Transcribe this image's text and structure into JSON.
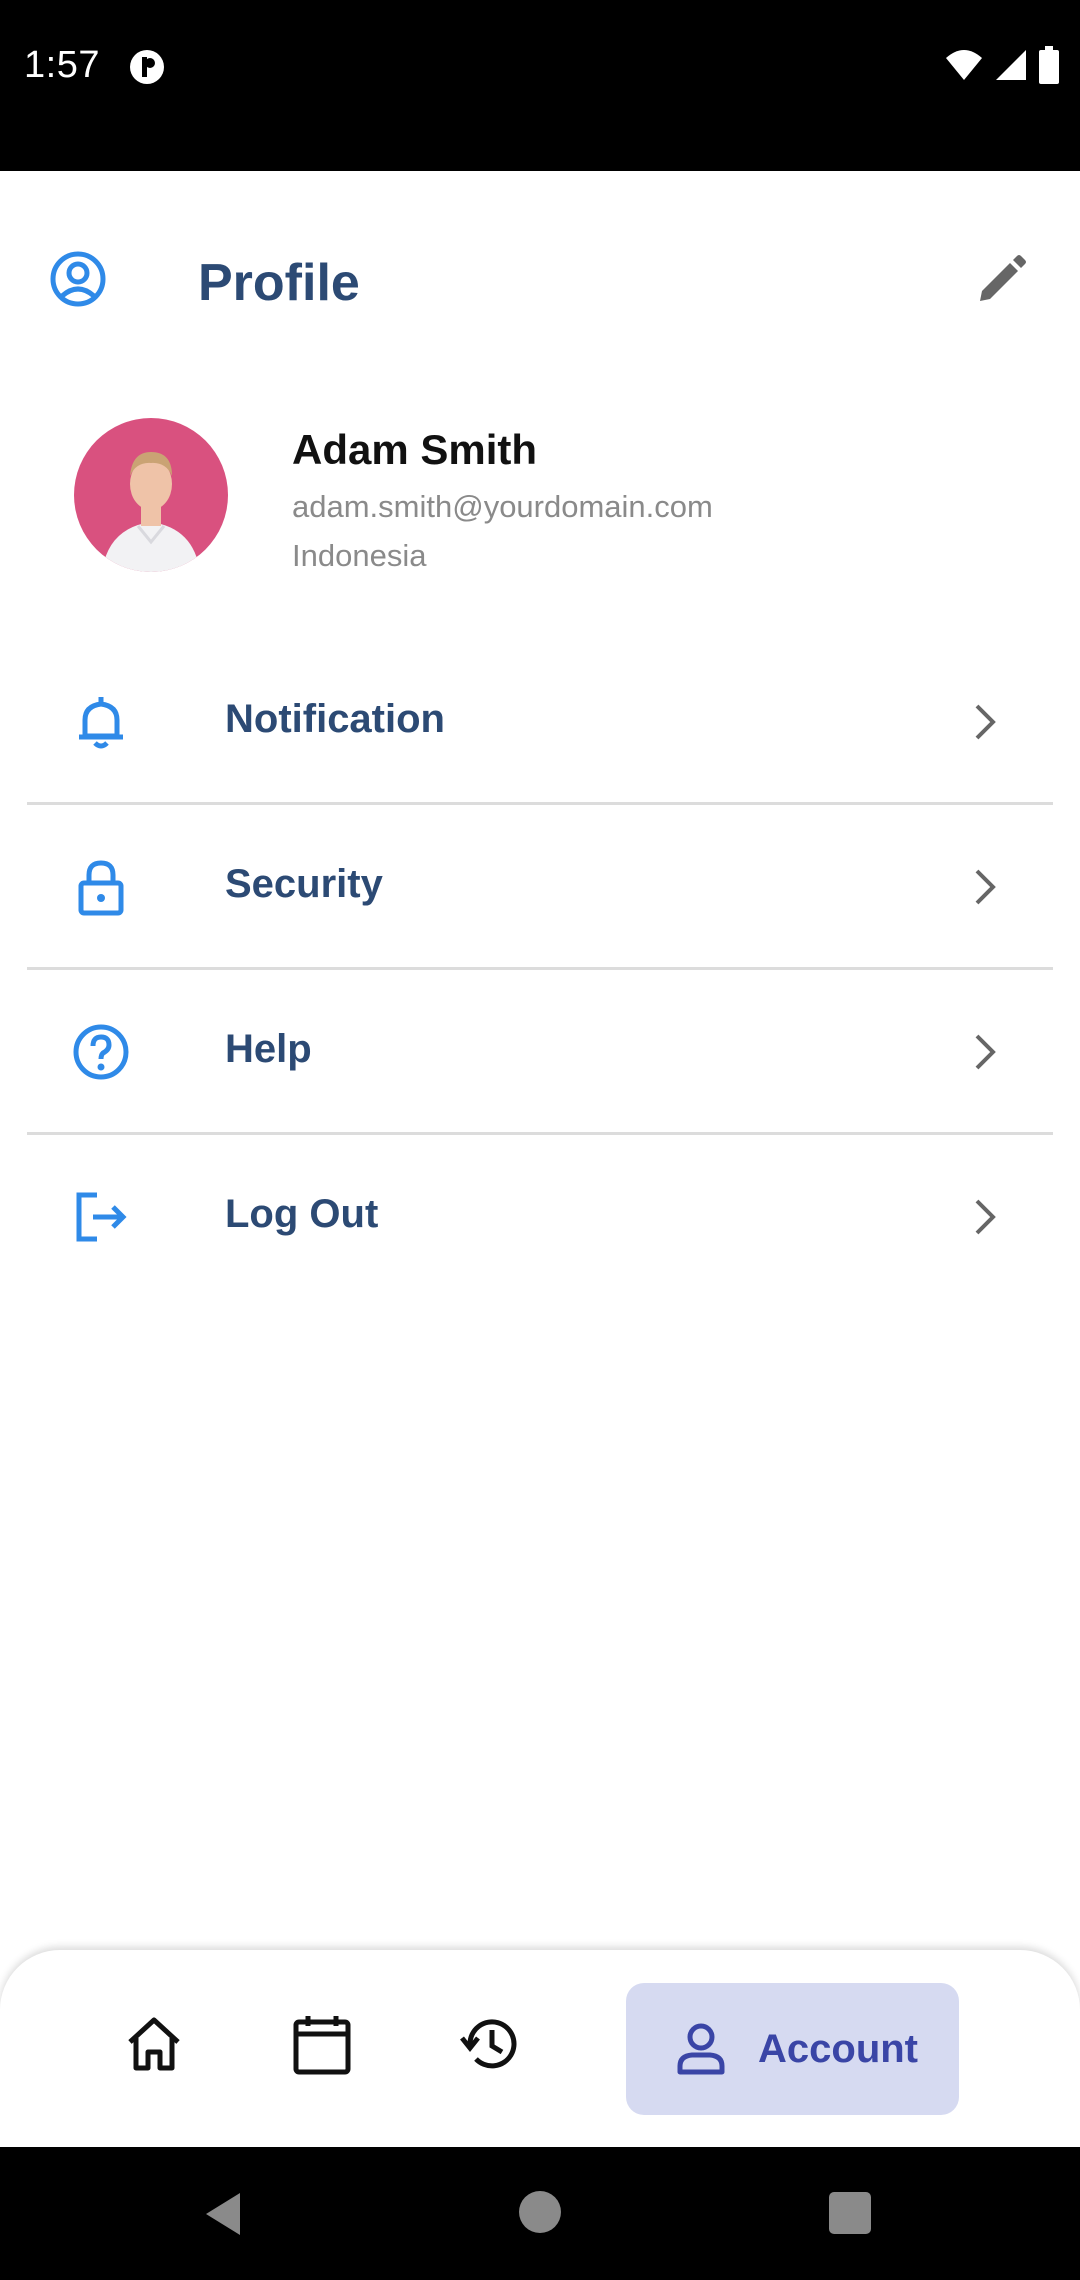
{
  "status_bar": {
    "time": "1:57",
    "icons": [
      "wifi-icon",
      "cell-signal-icon",
      "battery-icon"
    ]
  },
  "header": {
    "title": "Profile",
    "left_icon": "profile-circle-icon",
    "right_icon": "edit-pencil-icon"
  },
  "user": {
    "name": "Adam Smith",
    "email": "adam.smith@yourdomain.com",
    "country": "Indonesia"
  },
  "menu": {
    "items": [
      {
        "label": "Notification",
        "icon": "bell-icon"
      },
      {
        "label": "Security",
        "icon": "lock-icon"
      },
      {
        "label": "Help",
        "icon": "help-circle-icon"
      },
      {
        "label": "Log Out",
        "icon": "logout-icon"
      }
    ]
  },
  "bottom_nav": {
    "items": [
      "home-icon",
      "calendar-icon",
      "history-icon"
    ],
    "active_label": "Account",
    "active_icon": "person-icon"
  },
  "colors": {
    "accent": "#2f8ae8",
    "title": "#2c4a74",
    "nav_active_bg": "#d6daf1",
    "nav_active_text": "#3a45a6"
  }
}
